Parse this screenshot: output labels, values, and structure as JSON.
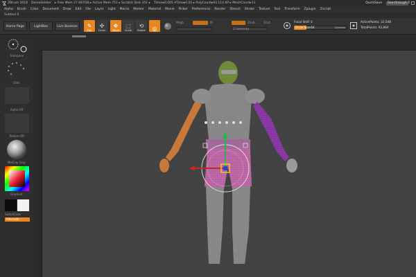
{
  "titlebar": {
    "segments": [
      "ZBrush 2018",
      "DemoSoldier",
      "▸ Free Mem 27.697GB ▸ Active Mem 751 ▸ Scratch Disk 351 ▸",
      "Timer▸0.005 ATime▸0.01 ▸ PolyCount▸93.114 KP ▸ MeshCount▸11"
    ],
    "quicksave": "QuickSave",
    "seethrough": "See-through  0"
  },
  "menu": [
    "Alpha",
    "Brush",
    "Color",
    "Document",
    "Draw",
    "Edit",
    "File",
    "Layer",
    "Light",
    "Macro",
    "Marker",
    "Material",
    "Movie",
    "Picker",
    "Preferences",
    "Render",
    "Stencil",
    "Stroke",
    "Texture",
    "Tool",
    "Transform",
    "Zplugin",
    "Zscript"
  ],
  "subbar": "Subtool 0",
  "toolbar": {
    "home_page": "Home Page",
    "lightbox": "LightBox",
    "live_boolean": "Live Boolean",
    "tools": [
      {
        "label": "Edit",
        "active": true,
        "glyph": "✎"
      },
      {
        "label": "Draw",
        "active": false,
        "glyph": "✣"
      },
      {
        "label": "Move",
        "active": true,
        "glyph": "✥"
      },
      {
        "label": "Scale",
        "active": false,
        "glyph": "⬚"
      },
      {
        "label": "Rotate",
        "active": false,
        "glyph": "⟲"
      },
      {
        "label": "",
        "active": true,
        "glyph": "◎"
      }
    ],
    "mrgb": "Mrgb",
    "rgb": "Rgb",
    "m": "M",
    "zadd": "Zadd",
    "zsub": "Zsub",
    "zcut": "Zcut",
    "rgb_intensity": "Rgb Intensity",
    "z_intensity": "Z Intensity",
    "focal_shift_label": "Focal Shift",
    "focal_shift_value": "0",
    "draw_size_label": "Draw Size",
    "draw_size_value": "64",
    "dynamic": "Dynamic",
    "active_points": "ActivePoints: 32,546",
    "total_points": "TotalPoints: 93,864"
  },
  "leftpanel": {
    "stroke_label": "Transpose",
    "alpha_label": "Dots",
    "alpha_off": "Alpha Off",
    "texture_off": "Texture Off",
    "matcap": "MatCap Gray",
    "gradient": "Gradient",
    "switch_color": "SwitchColor",
    "alternate": "Alternate"
  },
  "colors": {
    "accent": "#e8871f",
    "bg": "#2b2b2b",
    "canvas": "#434343"
  }
}
